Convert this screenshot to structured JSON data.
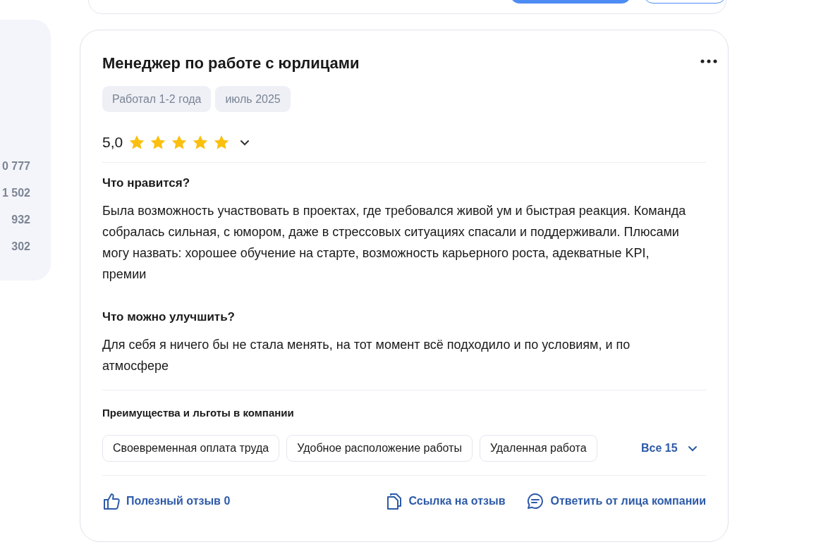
{
  "side_panel": {
    "values": [
      "0 777",
      "1 502",
      "932",
      "302"
    ]
  },
  "review": {
    "title": "Менеджер по работе с юрлицами",
    "tags": [
      "Работал 1-2 года",
      "июль 2025"
    ],
    "rating": "5,0",
    "stars": 5,
    "sections": [
      {
        "heading": "Что нравится?",
        "text": "Была возможность участвовать в проектах, где требовался живой ум и быстрая реакция. Команда собралась сильная, с юмором, даже в стрессовых ситуациях спасали и поддерживали. Плюсами могу назвать: хорошее обучение на старте, возможность карьерного роста, адекватные KPI, премии"
      },
      {
        "heading": "Что можно улучшить?",
        "text": "Для себя я ничего бы не стала менять, на тот момент всё подходило и по условиям, и по атмосфере"
      }
    ],
    "benefits": {
      "heading": "Преимущества и льготы в компании",
      "chips": [
        "Своевременная оплата труда",
        "Удобное расположение работы",
        "Удаленная работа"
      ],
      "more": "Все 15"
    },
    "actions": [
      {
        "kind": "like",
        "label": "Полезный отзыв 0"
      },
      {
        "kind": "link",
        "label": "Ссылка на отзыв"
      },
      {
        "kind": "reply",
        "label": "Ответить от лица компании"
      }
    ]
  }
}
